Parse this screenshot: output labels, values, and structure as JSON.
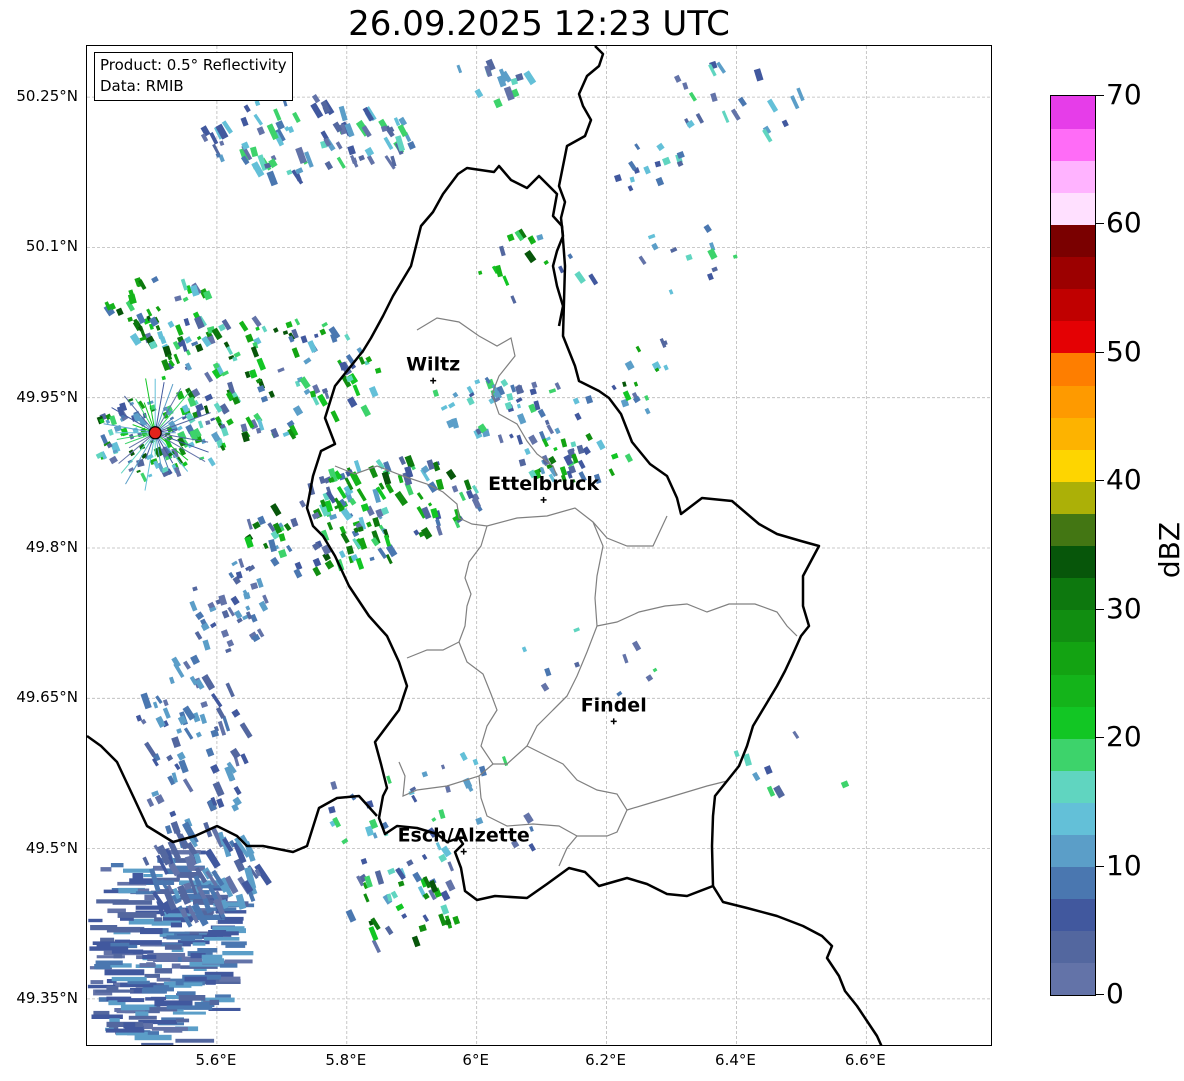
{
  "title": "26.09.2025 12:23 UTC",
  "info_box": {
    "product": "Product: 0.5° Reflectivity",
    "data_source": "Data: RMIB"
  },
  "axes": {
    "lat_labels": [
      {
        "value": 50.25,
        "text": "50.25°N"
      },
      {
        "value": 50.1,
        "text": "50.1°N"
      },
      {
        "value": 49.95,
        "text": "49.95°N"
      },
      {
        "value": 49.8,
        "text": "49.8°N"
      },
      {
        "value": 49.65,
        "text": "49.65°N"
      },
      {
        "value": 49.5,
        "text": "49.5°N"
      },
      {
        "value": 49.35,
        "text": "49.35°N"
      }
    ],
    "lon_labels": [
      {
        "value": 5.6,
        "text": "5.6°E"
      },
      {
        "value": 5.8,
        "text": "5.8°E"
      },
      {
        "value": 6.0,
        "text": "6°E"
      },
      {
        "value": 6.2,
        "text": "6.2°E"
      },
      {
        "value": 6.4,
        "text": "6.4°E"
      },
      {
        "value": 6.6,
        "text": "6.6°E"
      }
    ],
    "extent": {
      "lon_min": 5.4,
      "lon_max": 6.795,
      "lat_min": 49.302,
      "lat_max": 50.301
    },
    "grid": true
  },
  "cities": [
    {
      "name": "Wiltz",
      "lon": 5.933,
      "lat": 49.967
    },
    {
      "name": "Ettelbruck",
      "lon": 6.103,
      "lat": 49.848
    },
    {
      "name": "Findel",
      "lon": 6.211,
      "lat": 49.627
    },
    {
      "name": "Esch/Alzette",
      "lon": 5.98,
      "lat": 49.497
    }
  ],
  "radar_site": {
    "lon": 5.505,
    "lat": 49.915,
    "color": "#e3221b"
  },
  "colorbar": {
    "label": "dBZ",
    "min": 0,
    "max": 70,
    "step": 2.5,
    "ticks": [
      {
        "value": 0,
        "text": "0"
      },
      {
        "value": 10,
        "text": "10"
      },
      {
        "value": 20,
        "text": "20"
      },
      {
        "value": 30,
        "text": "30"
      },
      {
        "value": 40,
        "text": "40"
      },
      {
        "value": 50,
        "text": "50"
      },
      {
        "value": 60,
        "text": "60"
      },
      {
        "value": 70,
        "text": "70"
      }
    ],
    "colors": [
      "#6373a8",
      "#53679f",
      "#41589e",
      "#4a77b0",
      "#5b9ec8",
      "#63c0d8",
      "#60d5c0",
      "#3dd36b",
      "#12c624",
      "#14b41a",
      "#13a312",
      "#118e11",
      "#0d780e",
      "#07560a",
      "#437613",
      "#acb007",
      "#fed500",
      "#fdb300",
      "#fe9a00",
      "#fe7e00",
      "#e40104",
      "#c00000",
      "#9c0000",
      "#7a0000",
      "#ffe0ff",
      "#ffb3ff",
      "#ff6cf7",
      "#e63de9"
    ]
  },
  "colors": {
    "border_national": "#000000",
    "border_district": "#808080",
    "grid": "#b8b8b8"
  }
}
